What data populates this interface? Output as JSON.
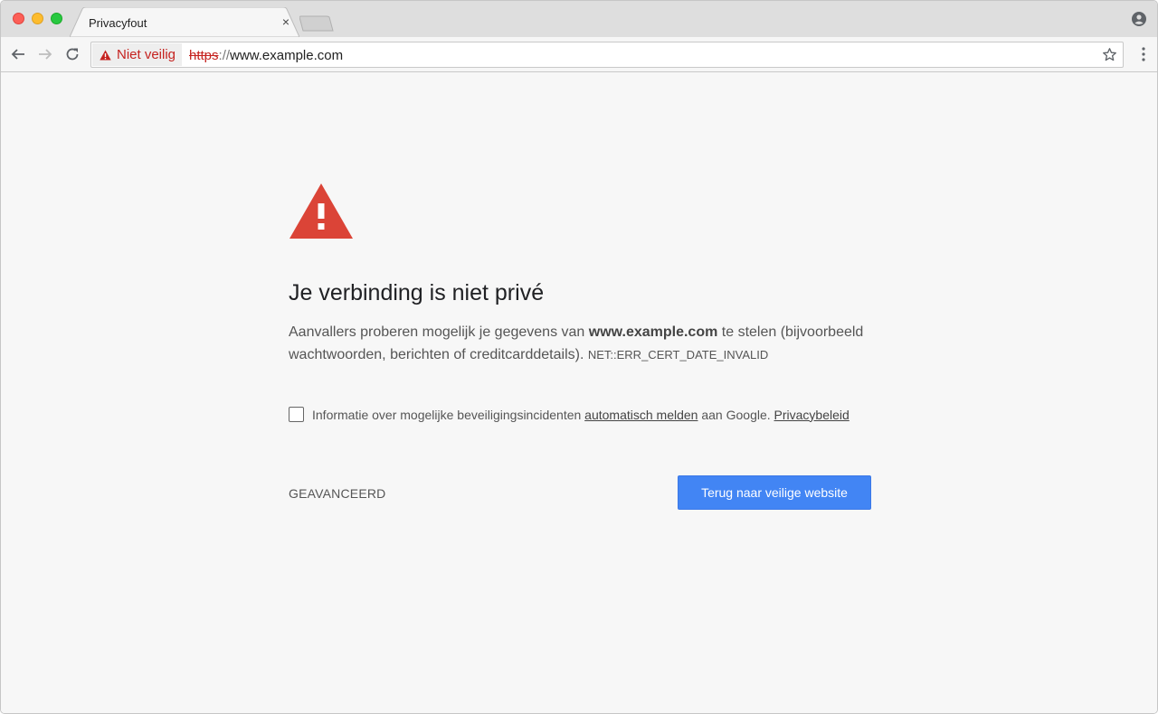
{
  "tab": {
    "title": "Privacyfout",
    "close_glyph": "×"
  },
  "toolbar": {
    "security_label": "Niet veilig",
    "url_scheme": "https",
    "url_separator": "://",
    "url_host": "www.example.com"
  },
  "page": {
    "heading": "Je verbinding is niet privé",
    "explanation_before": "Aanvallers proberen mogelijk je gegevens van ",
    "explanation_domain": "www.example.com",
    "explanation_after": " te stelen (bijvoorbeeld wachtwoorden, berichten of creditcarddetails). ",
    "error_code": "NET::ERR_CERT_DATE_INVALID",
    "report_before": "Informatie over mogelijke beveiligingsincidenten ",
    "report_link": "automatisch melden",
    "report_middle": " aan Google. ",
    "privacy_link": "Privacybeleid",
    "advanced_label": "GEAVANCEERD",
    "back_button_label": "Terug naar veilige website"
  },
  "colors": {
    "warning_red": "#db4437",
    "insecure_red": "#c5221f",
    "primary_blue": "#4285f4",
    "background": "#f7f7f7"
  },
  "icons": {
    "back": "arrow-left-icon",
    "forward": "arrow-right-icon",
    "reload": "reload-icon",
    "warning": "warning-triangle-icon",
    "star": "star-icon",
    "menu": "kebab-menu-icon",
    "profile": "profile-icon"
  }
}
